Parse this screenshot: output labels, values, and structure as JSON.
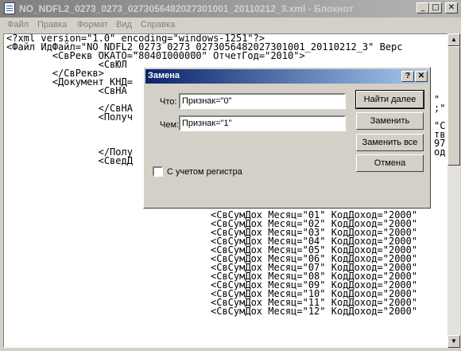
{
  "window": {
    "title": "NO_NDFL2_0273_0273_0273056482027301001_20110212_3.xml - Блокнот",
    "minimize": "_",
    "maximize": "□",
    "close": "✕",
    "app_icon": "notepad-icon"
  },
  "menu": [
    "Файл",
    "Правка",
    "Формат",
    "Вид",
    "Справка"
  ],
  "editor": {
    "lines": [
      "<?xml version=\"1.0\" encoding=\"windows-1251\"?>",
      "<Файл ИдФайл=\"NO_NDFL2_0273_0273_0273056482027301001_20110212_3\" Верс",
      "        <СвРекв ОКАТО=\"80401000000\" ОтчетГод=\"2010\">",
      "                <СвЮЛ",
      "        </СвРекв>",
      "        <Документ КНД=",
      "                <СвНА",
      "",
      "                </СвНА",
      "                <Получ",
      "",
      "",
      "",
      "                </Полу",
      "                <СведД",
      "",
      "",
      "",
      "",
      "",
      "",
      "",
      "",
      "",
      "",
      "",
      "",
      "",
      "",
      "",
      "",
      ""
    ],
    "partial_right": [
      {
        "row": 7,
        "text": "\""
      },
      {
        "row": 8,
        "text": ";\""
      },
      {
        "row": 10,
        "text": "\"С"
      },
      {
        "row": 11,
        "text": "тв"
      },
      {
        "row": 12,
        "text": "97"
      },
      {
        "row": 13,
        "text": "од"
      }
    ],
    "income_rows": [
      "<СвСумДох Месяц=\"01\" КодДоход=\"2000\"",
      "<СвСумДох Месяц=\"02\" КодДоход=\"2000\"",
      "<СвСумДох Месяц=\"03\" КодДоход=\"2000\"",
      "<СвСумДох Месяц=\"04\" КодДоход=\"2000\"",
      "<СвСумДох Месяц=\"05\" КодДоход=\"2000\"",
      "<СвСумДох Месяц=\"06\" КодДоход=\"2000\"",
      "<СвСумДох Месяц=\"07\" КодДоход=\"2000\"",
      "<СвСумДох Месяц=\"08\" КодДоход=\"2000\"",
      "<СвСумДох Месяц=\"09\" КодДоход=\"2000\"",
      "<СвСумДох Месяц=\"10\" КодДоход=\"2000\"",
      "<СвСумДох Месяц=\"11\" КодДоход=\"2000\"",
      "<СвСумДох Месяц=\"12\" КодДоход=\"2000\""
    ]
  },
  "dialog": {
    "title": "Замена",
    "help": "?",
    "close": "✕",
    "find_label": "Что:",
    "find_value": "Признак=\"0\"",
    "replace_label": "Чем:",
    "replace_value": "Признак=\"1\"",
    "match_case_label": "С учетом регистра",
    "buttons": {
      "find_next": "Найти далее",
      "replace": "Заменить",
      "replace_all": "Заменить все",
      "cancel": "Отмена"
    }
  }
}
